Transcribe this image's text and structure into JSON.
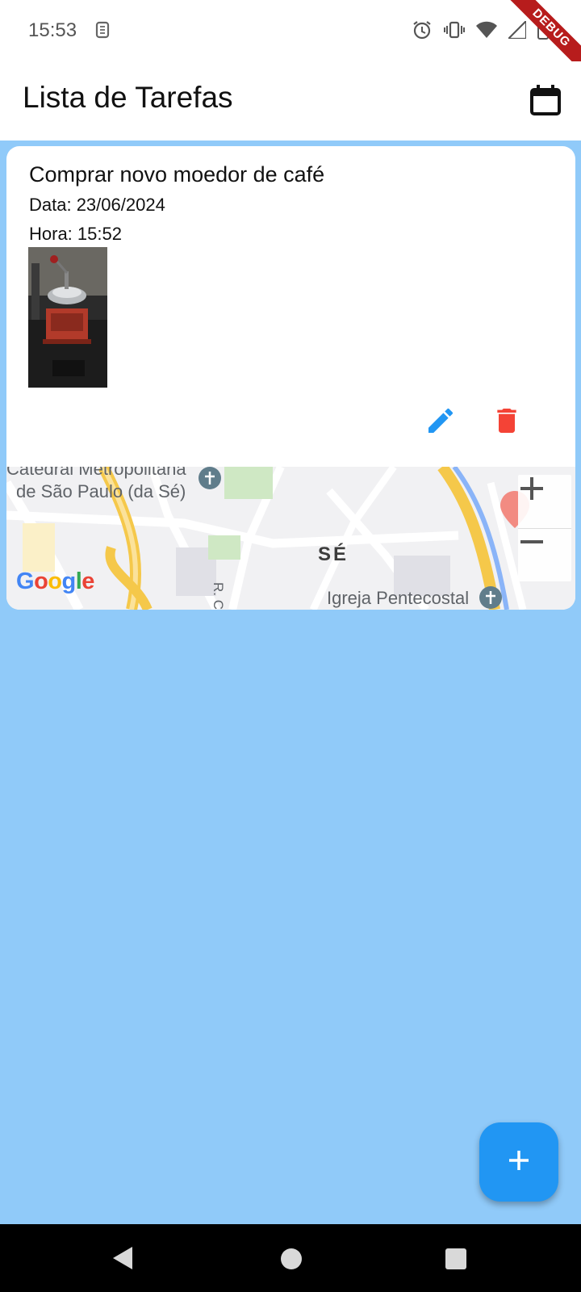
{
  "status_bar": {
    "time": "15:53",
    "left_icon": "sim-icon",
    "right_icons": [
      "alarm-icon",
      "vibrate-icon",
      "wifi-icon",
      "signal-icon",
      "battery-icon"
    ],
    "debug_ribbon": "DEBUG"
  },
  "app_bar": {
    "title": "Lista de Tarefas",
    "action_icon": "calendar-icon"
  },
  "tasks": [
    {
      "title": "Comprar novo moedor de café",
      "date": "Data: 23/06/2024",
      "time": "Hora: 15:52",
      "photo": "coffee-grinder-photo",
      "actions": [
        "edit-icon",
        "delete-icon"
      ],
      "map": {
        "labels": {
          "cathedral_line1": "Catedral Metropolitana",
          "cathedral_line2": "de São Paulo (da Sé)",
          "district": "SÉ",
          "church": "Igreja Pentecostal",
          "street": "R. C"
        },
        "logo": "Google",
        "zoom_in": "+",
        "zoom_out": "−"
      }
    }
  ],
  "fab": {
    "icon": "add-icon"
  },
  "colors": {
    "background": "#90caf9",
    "edit": "#2196f3",
    "delete": "#f44336",
    "fab": "#2196f3"
  }
}
